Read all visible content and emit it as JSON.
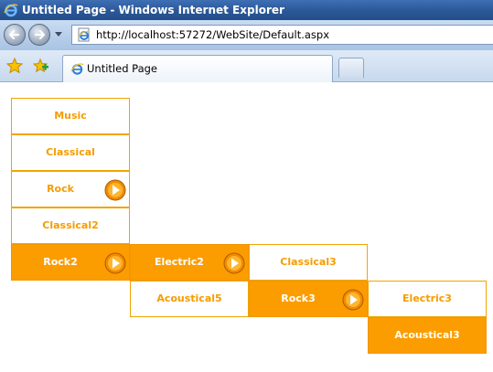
{
  "window": {
    "title": "Untitled Page - Windows Internet Explorer"
  },
  "address_bar": {
    "url": "http://localhost:57272/WebSite/Default.aspx"
  },
  "tab": {
    "label": "Untitled Page"
  },
  "colors": {
    "menu_accent": "#fb9d00",
    "menu_text": "#f59c00",
    "titlebar": "#2a5796"
  },
  "icons": {
    "back": "back-arrow-icon",
    "forward": "forward-arrow-icon",
    "favorites": "star-icon",
    "add_favorites": "add-favorite-icon",
    "submenu": "submenu-arrow-icon"
  },
  "menu": {
    "level1": {
      "music": "Music",
      "classical": "Classical",
      "rock": "Rock",
      "classical2": "Classical2",
      "rock2": "Rock2"
    },
    "level2": {
      "electric2": "Electric2",
      "acoustical5": "Acoustical5"
    },
    "level3": {
      "classical3": "Classical3",
      "rock3": "Rock3"
    },
    "level4": {
      "electric3": "Electric3",
      "acoustical3": "Acoustical3"
    }
  }
}
